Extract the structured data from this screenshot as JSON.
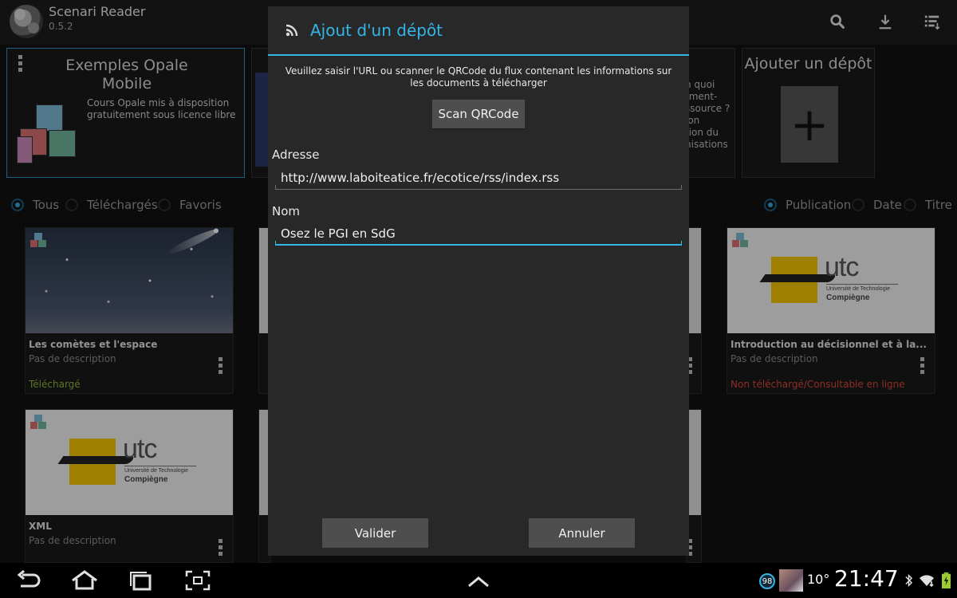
{
  "app": {
    "title": "Scenari Reader",
    "version": "0.5.2"
  },
  "toolbar": {
    "icons": [
      "search-icon",
      "download-icon",
      "sort-list-icon"
    ]
  },
  "repositories": {
    "selected": {
      "title": "Exemples Opale Mobile",
      "description": "Cours Opale mis à disposition gratuitement sous licence libre"
    },
    "partial_text": [
      "n quoi",
      "rment-",
      "ssource ?",
      "ion",
      "tion du",
      "nisations"
    ],
    "add": {
      "title": "Ajouter un dépôt"
    }
  },
  "filters": {
    "left": [
      {
        "label": "Tous",
        "checked": true
      },
      {
        "label": "Téléchargés",
        "checked": false
      },
      {
        "label": "Favoris",
        "checked": false
      }
    ],
    "sort": [
      {
        "label": "Publication",
        "checked": true
      },
      {
        "label": "Date",
        "checked": false
      },
      {
        "label": "Titre",
        "checked": false
      }
    ]
  },
  "documents": [
    {
      "title": "Les comètes et l'espace",
      "description": "Pas de description",
      "status": "Téléchargé",
      "status_color": "#8fb33c"
    },
    {
      "title": "Introduction au décisionnel et à la...",
      "description": "Pas de description",
      "status": "Non téléchargé/Consultable en ligne",
      "status_color": "#d9453b"
    },
    {
      "title": "XML",
      "description": "Pas de description"
    }
  ],
  "utc_logo": {
    "word": "utc",
    "line1": "Université de Technologie",
    "line2": "Compiègne"
  },
  "dialog": {
    "title": "Ajout d'un dépôt",
    "message": "Veuillez saisir l'URL ou scanner le QRCode du flux contenant les informations sur les documents à télécharger",
    "scan_label": "Scan QRCode",
    "address_label": "Adresse",
    "address_value": "http://www.laboiteatice.fr/ecotice/rss/index.rss",
    "name_label": "Nom",
    "name_value": "Osez le PGI en SdG",
    "ok_label": "Valider",
    "cancel_label": "Annuler",
    "accent": "#33b5e5"
  },
  "status_bar": {
    "badge": "98",
    "temperature": "10°",
    "time": "21:47"
  }
}
